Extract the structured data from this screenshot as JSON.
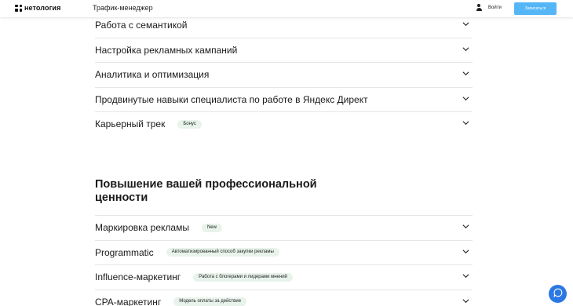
{
  "header": {
    "logo_text": "нетология",
    "product_name": "Трафик-менеджер",
    "login_label": "Войти",
    "signup_label": "Записаться"
  },
  "modules": [
    {
      "title": "Работа с семантикой"
    },
    {
      "title": "Настройка рекламных кампаний"
    },
    {
      "title": "Аналитика и оптимизация"
    },
    {
      "title": "Продвинутые навыки специалиста по работе в Яндекс Директ"
    },
    {
      "title": "Карьерный трек",
      "badge": "Бонус"
    }
  ],
  "extra_section": {
    "title": "Повышение вашей профессиональной ценности",
    "items": [
      {
        "title": "Маркировка рекламы",
        "badge": "New"
      },
      {
        "title": "Programmatic",
        "badge": "Автоматизированный способ закупки рекламы"
      },
      {
        "title": "Influence-маркетинг",
        "badge": "Работа с блогерами и лидерами мнений"
      },
      {
        "title": "CPA-маркетинг",
        "badge": "Модель оплаты за действие"
      }
    ]
  },
  "icons": {
    "chevron": "chevron-down-icon",
    "user": "user-icon",
    "chat": "chat-icon"
  },
  "colors": {
    "accent": "#55b6f7",
    "chat_button": "#2b78e4",
    "badge_bg": "#e8f3ec"
  }
}
